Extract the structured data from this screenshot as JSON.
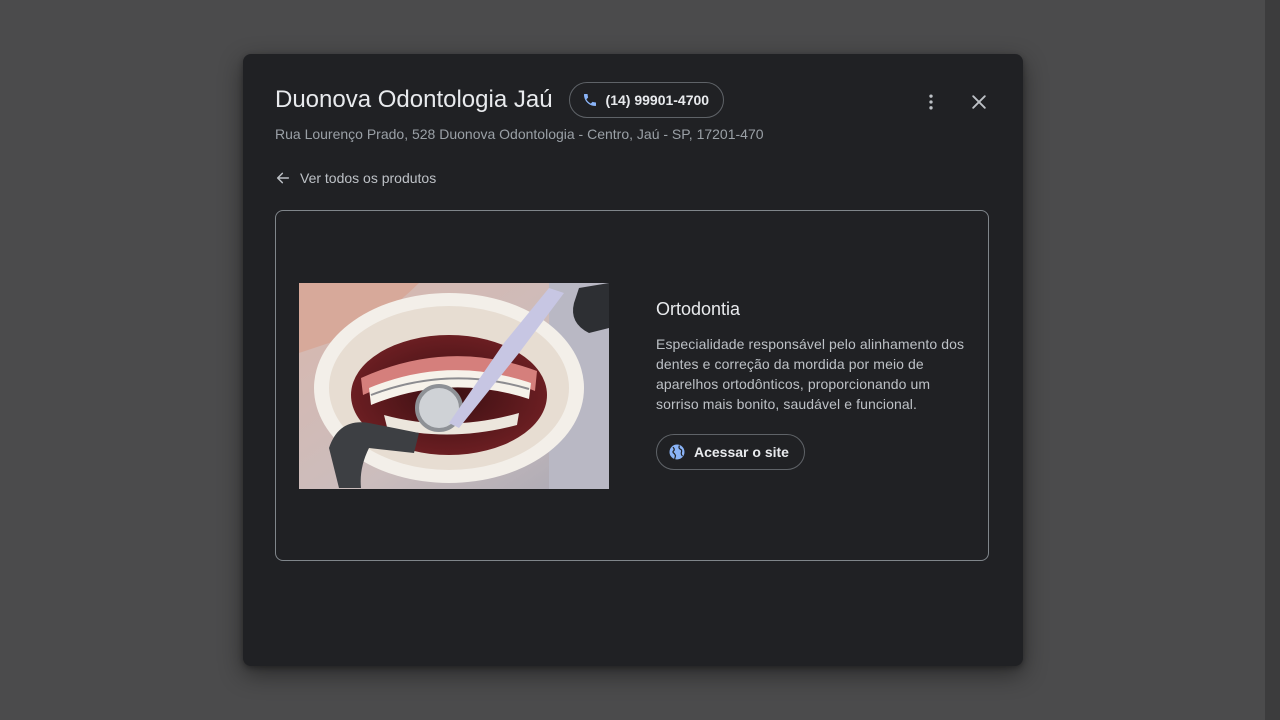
{
  "business": {
    "name": "Duonova Odontologia Jaú",
    "phone": "(14) 99901-4700",
    "address": "Rua Lourenço Prado, 528 Duonova Odontologia - Centro, Jaú - SP, 17201-470"
  },
  "navigation": {
    "back_label": "Ver todos os produtos"
  },
  "product": {
    "name": "Ortodontia",
    "description": "Especialidade responsável pelo alinhamento dos dentes e correção da mordida por meio de aparelhos ortodônticos, proporcionando um sorriso mais bonito, saudável e funcional.",
    "site_button_label": "Acessar o site"
  },
  "icons": {
    "phone": "phone-icon",
    "more": "more-vertical-icon",
    "close": "close-icon",
    "back": "arrow-left-icon",
    "site": "globe-icon"
  },
  "colors": {
    "dialog_bg": "#202124",
    "accent_blue": "#8ab4f8",
    "text_primary": "#e8eaed",
    "text_secondary": "#9aa0a6",
    "border": "#5f6368"
  }
}
